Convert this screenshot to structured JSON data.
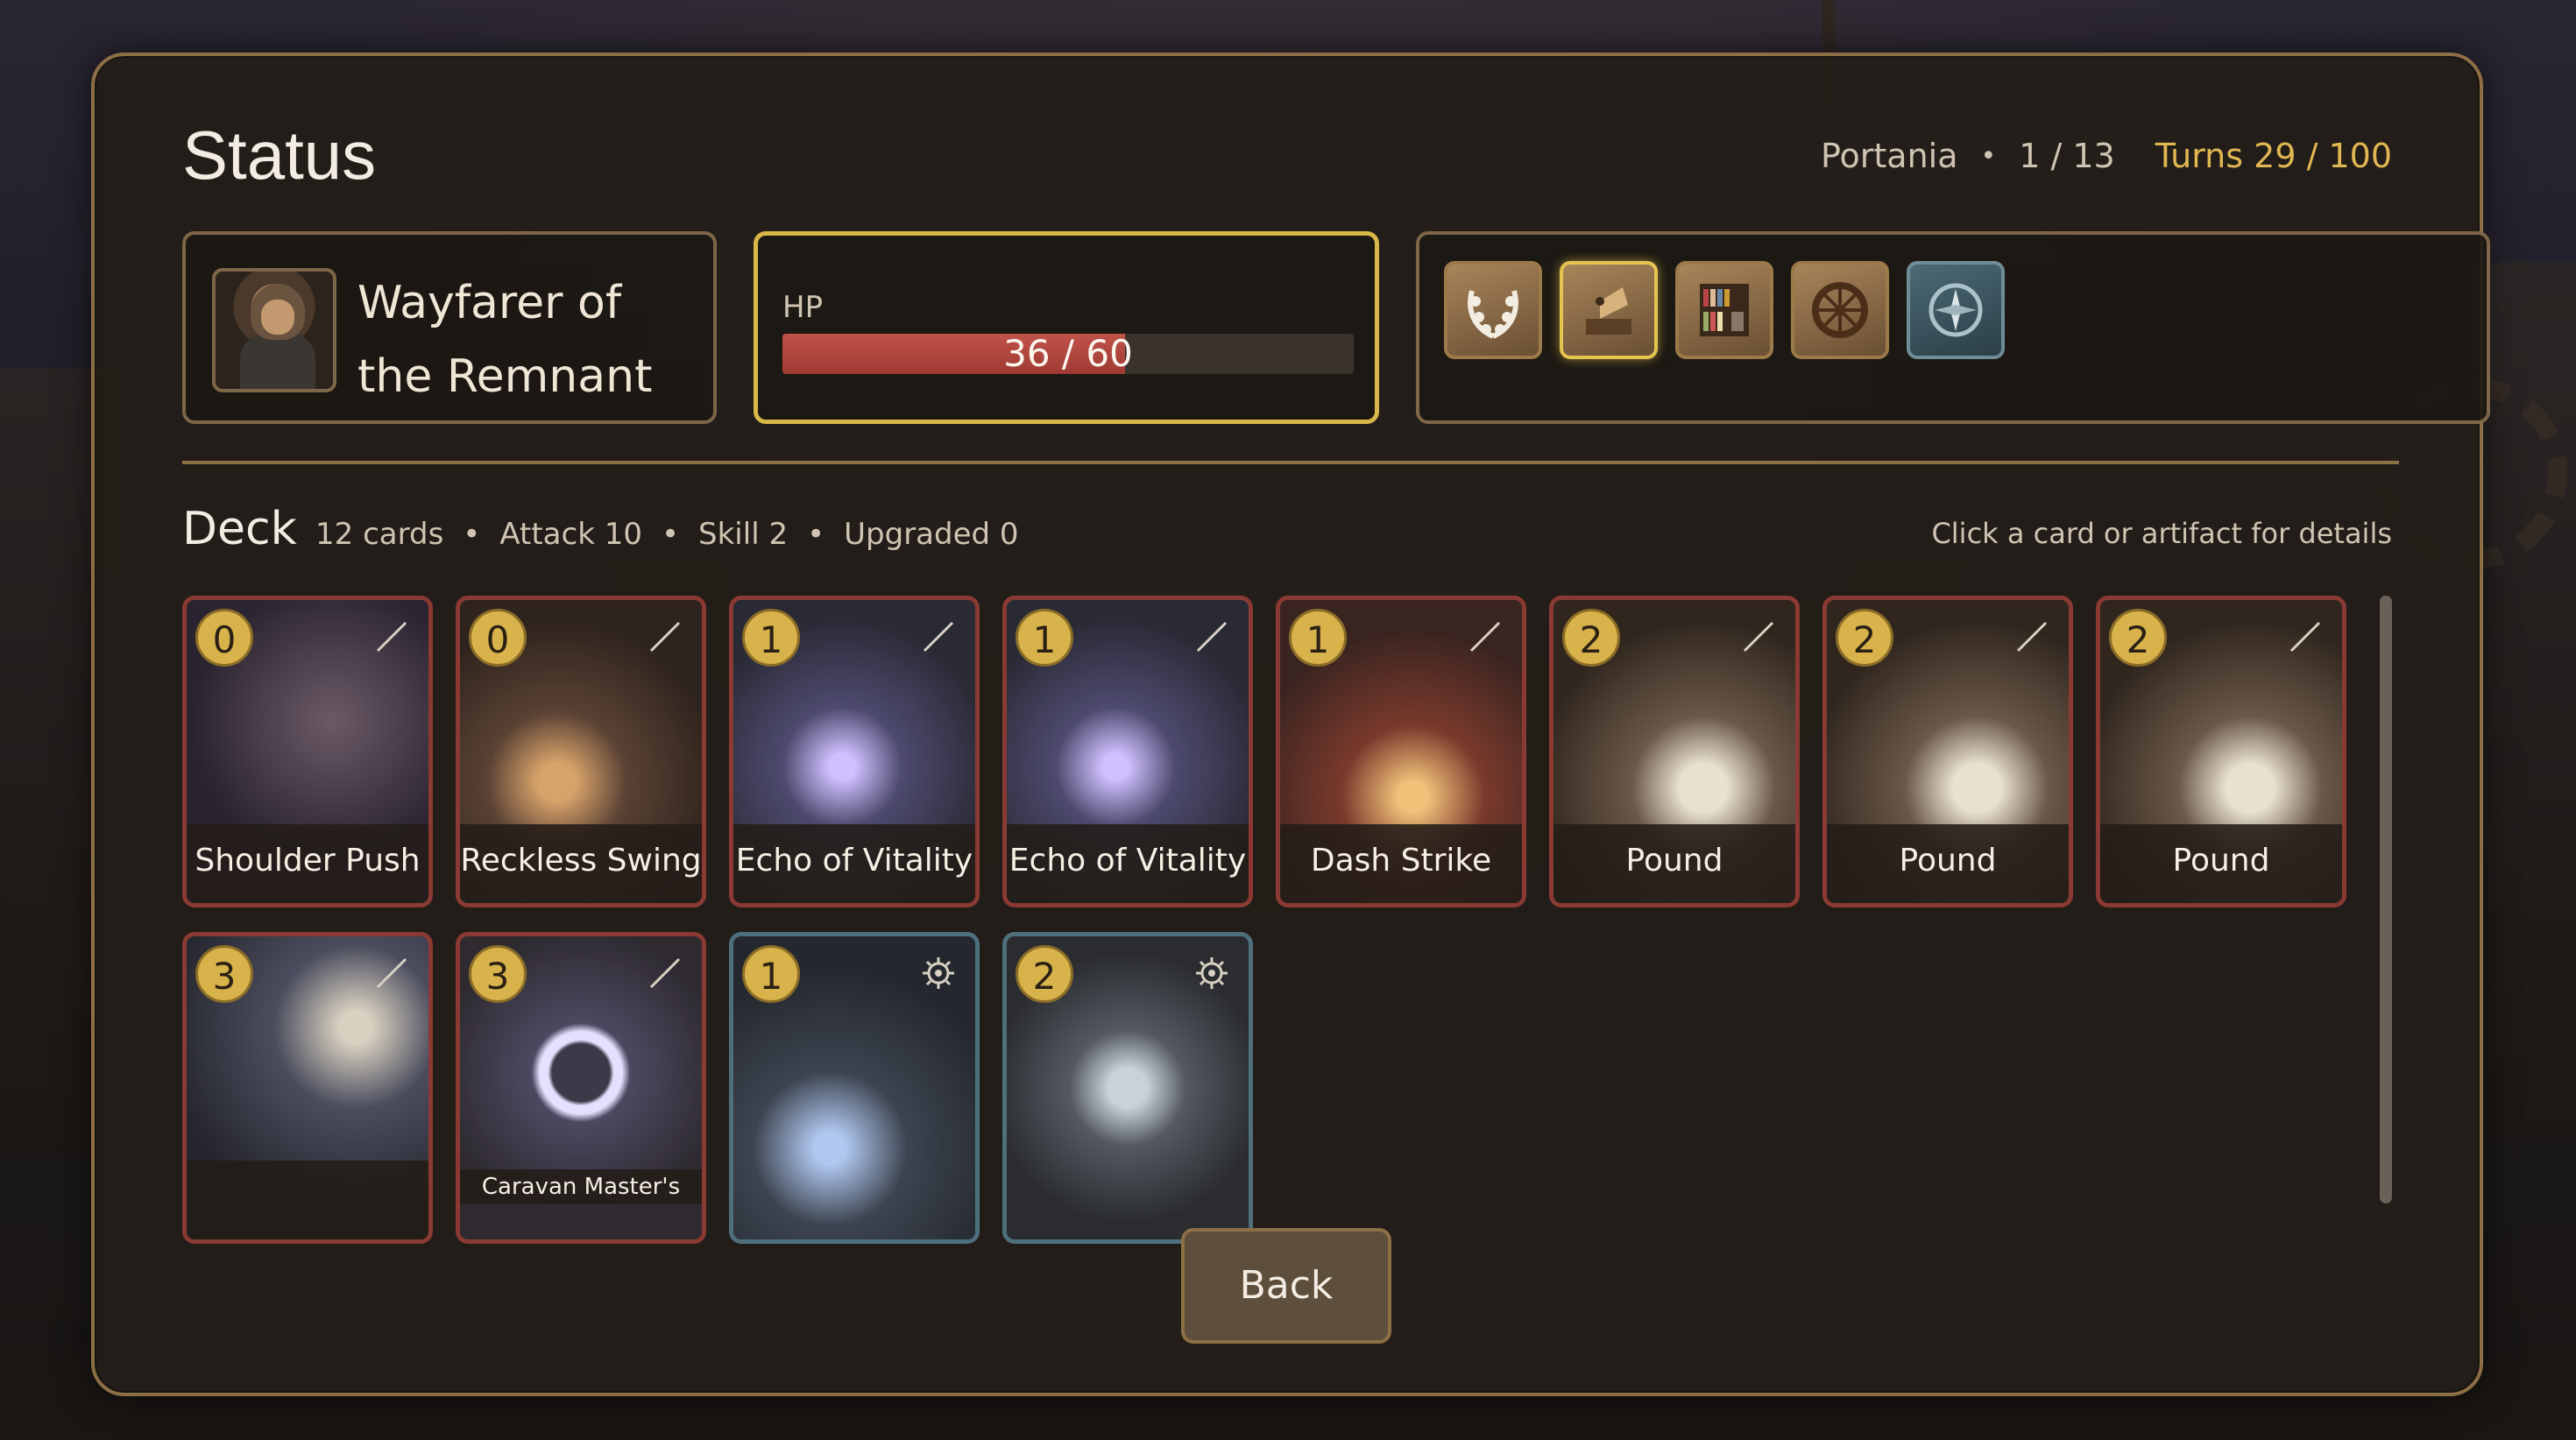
{
  "header": {
    "title": "Status",
    "location": "Portania",
    "progress": "1 / 13",
    "turns": "Turns 29 / 100"
  },
  "hero": {
    "name": "Wayfarer of the Remnant"
  },
  "hp": {
    "label": "HP",
    "current": 36,
    "max": 60,
    "text": "36 / 60",
    "fill_fraction": 0.6,
    "fill_color": "#c0534a"
  },
  "artifacts": [
    {
      "icon": "laurel-wreath-icon",
      "selected": false
    },
    {
      "icon": "gramophone-icon",
      "selected": true
    },
    {
      "icon": "bookshelf-icon",
      "selected": false
    },
    {
      "icon": "wooden-wheel-icon",
      "selected": false
    },
    {
      "icon": "compass-rose-icon",
      "selected": false
    }
  ],
  "deck": {
    "title": "Deck",
    "cards_count": "12 cards",
    "attack": "Attack 10",
    "skill": "Skill 2",
    "upgraded": "Upgraded 0",
    "hint": "Click a card or artifact for details",
    "cards": [
      {
        "cost": "0",
        "name": "Shoulder Push",
        "type": "attack"
      },
      {
        "cost": "0",
        "name": "Reckless Swing",
        "type": "attack"
      },
      {
        "cost": "1",
        "name": "Echo of Vitality",
        "type": "attack"
      },
      {
        "cost": "1",
        "name": "Echo of Vitality",
        "type": "attack"
      },
      {
        "cost": "1",
        "name": "Dash Strike",
        "type": "attack"
      },
      {
        "cost": "2",
        "name": "Pound",
        "type": "attack"
      },
      {
        "cost": "2",
        "name": "Pound",
        "type": "attack"
      },
      {
        "cost": "2",
        "name": "Pound",
        "type": "attack"
      },
      {
        "cost": "3",
        "name": "",
        "type": "attack"
      },
      {
        "cost": "3",
        "name": "Caravan Master's",
        "type": "attack"
      },
      {
        "cost": "1",
        "name": "",
        "type": "skill"
      },
      {
        "cost": "2",
        "name": "",
        "type": "skill"
      }
    ]
  },
  "back_button": "Back",
  "colors": {
    "accent_gold": "#e0b752",
    "attack_border": "#8a3a32",
    "skill_border": "#4e6f7c",
    "panel_border": "#8d6f45"
  }
}
